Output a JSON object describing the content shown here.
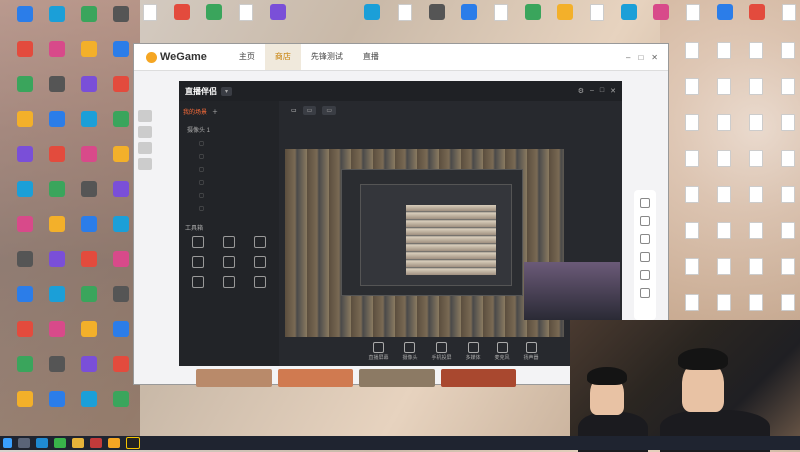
{
  "desktop": {
    "icons_left_col1": [
      "",
      "",
      "",
      "",
      "",
      "",
      "",
      "",
      "",
      "",
      "",
      ""
    ],
    "icons_top": [],
    "icons_right": []
  },
  "wegame": {
    "logo": "WeGame",
    "nav": [
      "主页",
      "商店",
      "先锋测试",
      "直播"
    ],
    "active_nav": 1
  },
  "live_app": {
    "logo": "直播伴侣",
    "version": "",
    "tabs": [
      "我的场景",
      "",
      "",
      ""
    ],
    "scene_root": "摄像头 1",
    "scenes": [
      "",
      "",
      "",
      "",
      "",
      ""
    ],
    "tools_header": "工具箱",
    "tools": [
      "",
      "",
      "",
      "",
      "",
      "",
      "",
      "",
      "",
      "",
      "",
      ""
    ],
    "stream_title": "",
    "chips": [
      "",
      "",
      ""
    ],
    "stat": "",
    "bottom_buttons": [
      "直播屏幕",
      "摄像头",
      "手机投屏",
      "多媒体",
      "麦克风",
      "扬声器"
    ],
    "footer_left": "",
    "footer_right": ""
  },
  "colors": {
    "accent_orange": "#ff6d3a",
    "wegame_active": "#c67d00"
  },
  "icons": {
    "taskbar": [
      "windows-start-icon",
      "search-icon",
      "edge-icon",
      "wechat-icon",
      "explorer-icon",
      "app-icon",
      "wegame-icon",
      "live-icon"
    ]
  }
}
